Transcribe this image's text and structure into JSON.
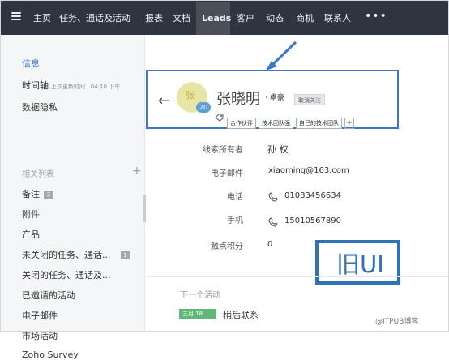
{
  "top_nav": {
    "items": [
      "主页",
      "任务、通话及活动",
      "报表",
      "文档",
      "Leads",
      "客户",
      "动态",
      "商机",
      "联系人"
    ],
    "more": "•••"
  },
  "sidebar": {
    "top_items": [
      "信息",
      "时间轴",
      "数据隐私"
    ],
    "timeline_note": "上次更新时间 : 04:10 下午",
    "section_label": "相关列表",
    "related_items": [
      "备注",
      "附件",
      "产品",
      "未关闭的任务、通话...",
      "关闭的任务、通话及...",
      "已邀请的活动",
      "电子邮件",
      "市场活动",
      "Zoho Survey"
    ],
    "counts": {
      "notes": "2",
      "open_tasks": "1"
    }
  },
  "lead": {
    "avatar_text": "张",
    "score": "20",
    "name": "张晓明",
    "company": "· 卓豪",
    "follow_button": "取消关注",
    "tags": [
      "合作伙伴",
      "技术团队强",
      "自己的技术团队"
    ],
    "add_tag": "+"
  },
  "details": {
    "owner_label": "线索所有者",
    "owner_value": "孙 权",
    "email_label": "电子邮件",
    "email_value": "xiaoming@163.com",
    "phone_label": "电话",
    "phone_value": "01083456634",
    "mobile_label": "手机",
    "mobile_value": "15010567890",
    "touch_score_label": "触点积分",
    "touch_score_value": "0"
  },
  "next_activity": {
    "label": "下一个活动",
    "date": "三月 18",
    "title": "稍后联系"
  },
  "annotation": {
    "old_ui": "旧UI"
  },
  "watermark": "@ITPUB博客",
  "colors": {
    "nav_bg": "#2f3540",
    "accent": "#3a79c9",
    "old_ui_blue": "#2f72b5",
    "green_badge": "#60b876"
  },
  "icons": [
    "menu-icon",
    "back-arrow-icon",
    "tag-icon",
    "phone-icon",
    "mobile-icon",
    "plus-icon"
  ]
}
